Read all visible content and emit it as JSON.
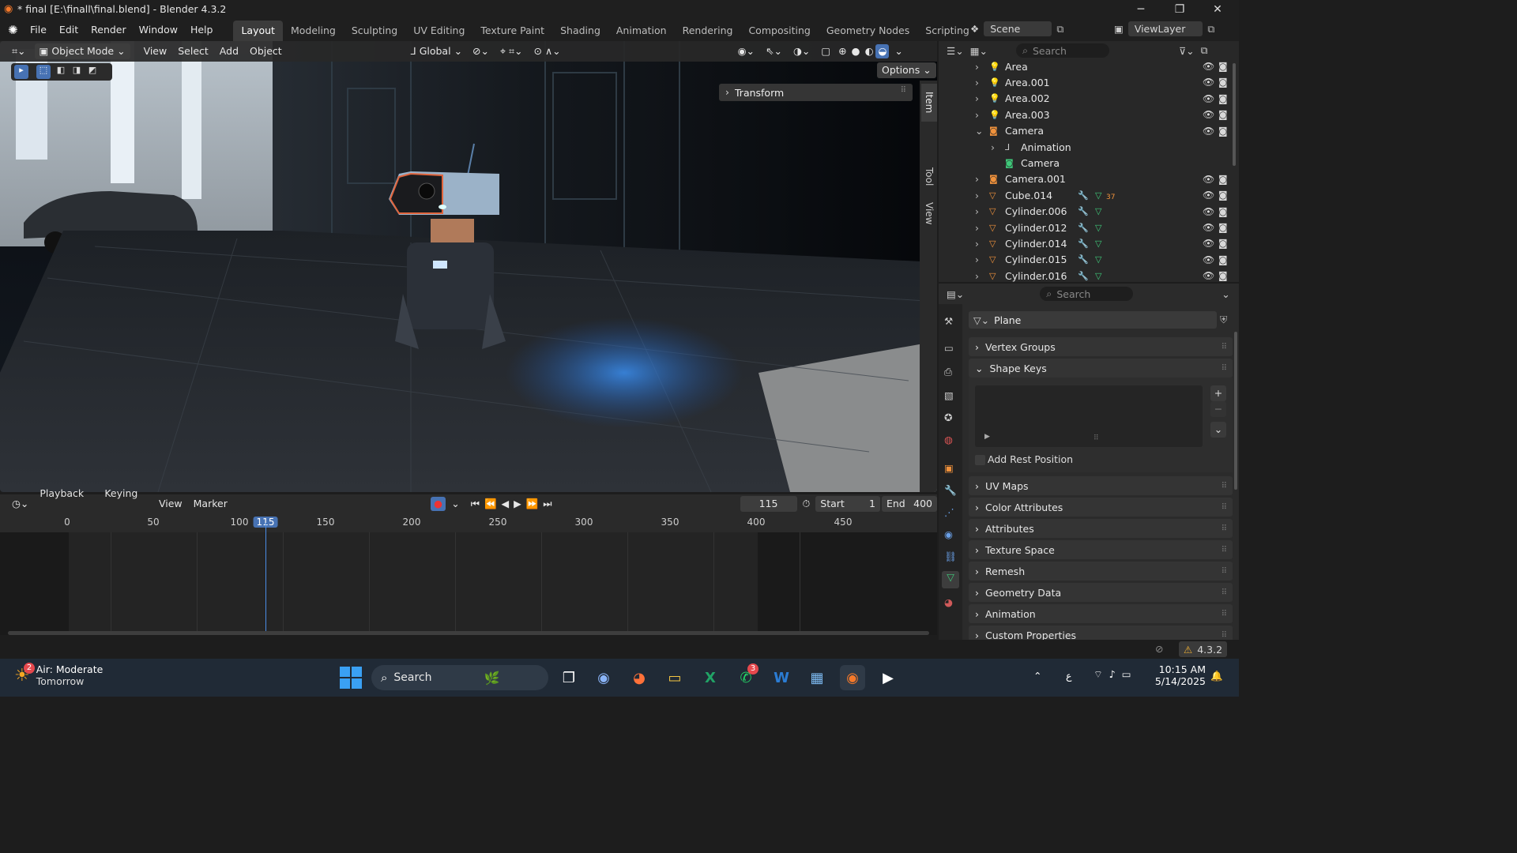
{
  "window": {
    "title": "* final [E:\\finall\\final.blend] - Blender 4.3.2",
    "minimize": "─",
    "maximize": "❐",
    "close": "✕"
  },
  "menu": [
    "File",
    "Edit",
    "Render",
    "Window",
    "Help"
  ],
  "workspaces": [
    "Layout",
    "Modeling",
    "Sculpting",
    "UV Editing",
    "Texture Paint",
    "Shading",
    "Animation",
    "Rendering",
    "Compositing",
    "Geometry Nodes",
    "Scripting"
  ],
  "workspace_add": "+",
  "scene": {
    "name": "Scene",
    "view_layer": "ViewLayer"
  },
  "viewport": {
    "mode": "Object Mode",
    "menus": [
      "View",
      "Select",
      "Add",
      "Object"
    ],
    "orientation": "Global",
    "options": "Options",
    "n_panel": {
      "transform": "Transform",
      "tabs": [
        "Item",
        "Tool",
        "View"
      ]
    }
  },
  "timeline": {
    "menus": [
      "Playback",
      "Keying",
      "View",
      "Marker"
    ],
    "current_frame": "115",
    "start_label": "Start",
    "start": "1",
    "end_label": "End",
    "end": "400",
    "ticks": [
      "0",
      "50",
      "100",
      "115",
      "150",
      "200",
      "250",
      "300",
      "350",
      "400",
      "450"
    ]
  },
  "outliner": {
    "search_placeholder": "Search",
    "items": [
      {
        "name": "Area",
        "indent": 0,
        "expander": "›",
        "type": "light"
      },
      {
        "name": "Area.001",
        "indent": 0,
        "expander": "›",
        "type": "light"
      },
      {
        "name": "Area.002",
        "indent": 0,
        "expander": "›",
        "type": "light"
      },
      {
        "name": "Area.003",
        "indent": 0,
        "expander": "›",
        "type": "light"
      },
      {
        "name": "Camera",
        "indent": 0,
        "expander": "⌄",
        "type": "camera"
      },
      {
        "name": "Animation",
        "indent": 1,
        "expander": "›",
        "type": "anim"
      },
      {
        "name": "Camera",
        "indent": 1,
        "expander": "",
        "type": "camdata"
      },
      {
        "name": "Camera.001",
        "indent": 0,
        "expander": "›",
        "type": "camera"
      },
      {
        "name": "Cube.014",
        "indent": 0,
        "expander": "›",
        "type": "mesh",
        "badge": "37"
      },
      {
        "name": "Cylinder.006",
        "indent": 0,
        "expander": "›",
        "type": "mesh"
      },
      {
        "name": "Cylinder.012",
        "indent": 0,
        "expander": "›",
        "type": "mesh"
      },
      {
        "name": "Cylinder.014",
        "indent": 0,
        "expander": "›",
        "type": "mesh"
      },
      {
        "name": "Cylinder.015",
        "indent": 0,
        "expander": "›",
        "type": "mesh"
      },
      {
        "name": "Cylinder.016",
        "indent": 0,
        "expander": "›",
        "type": "mesh"
      }
    ]
  },
  "properties": {
    "search_placeholder": "Search",
    "data_name": "Plane",
    "panels_top": [
      "Vertex Groups",
      "Shape Keys"
    ],
    "add_rest_position": "Add Rest Position",
    "panels_bottom": [
      "UV Maps",
      "Color Attributes",
      "Attributes",
      "Texture Space",
      "Remesh",
      "Geometry Data",
      "Animation",
      "Custom Properties"
    ],
    "shape_key_add": "+",
    "shape_key_remove": "−",
    "shape_key_menu": "⌄"
  },
  "status": {
    "version": "4.3.2"
  },
  "taskbar": {
    "weather": "Air: Moderate",
    "weather_sub": "Tomorrow",
    "weather_badge": "2",
    "search": "Search",
    "whatsapp_badge": "3",
    "time": "10:15 AM",
    "date": "5/14/2025",
    "lang": "ع"
  }
}
